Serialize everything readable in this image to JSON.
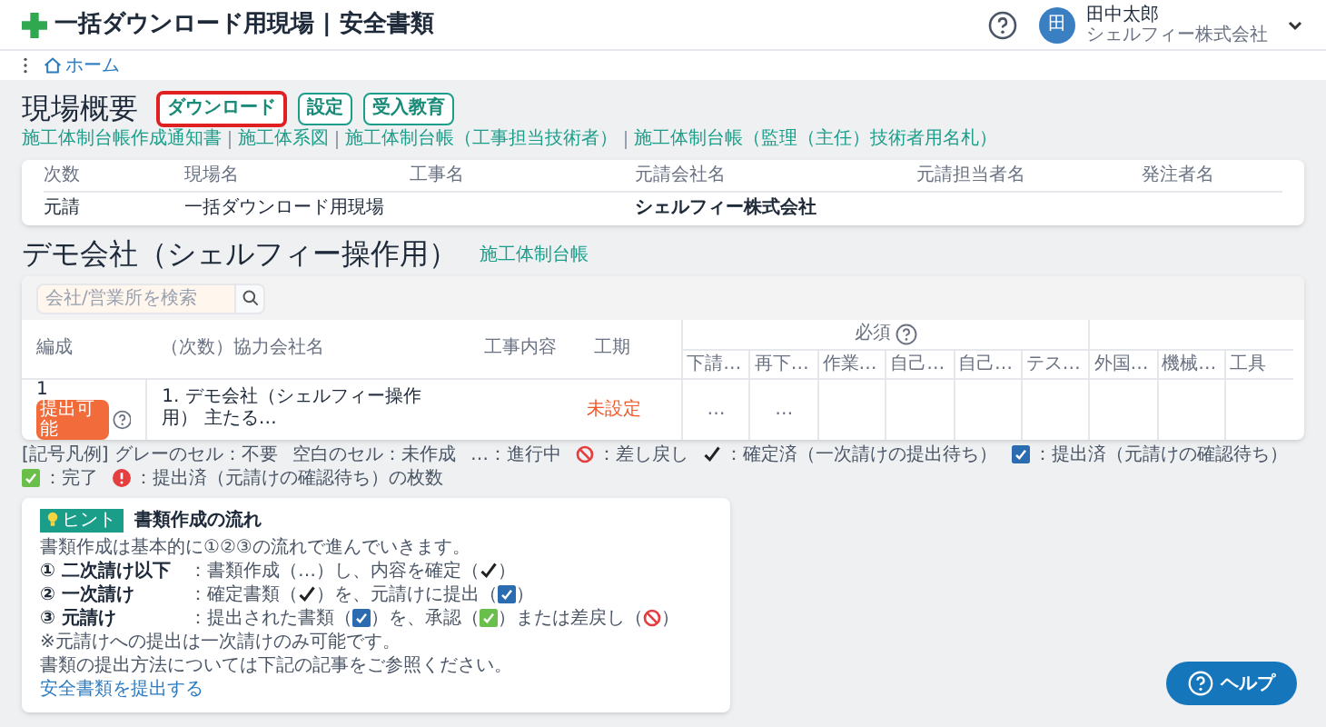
{
  "header": {
    "title": "一括ダウンロード用現場 | 安全書類",
    "user": {
      "avatar": "田",
      "name": "田中太郎",
      "company": "シェルフィー株式会社"
    }
  },
  "breadcrumb": [
    {
      "label": "ホーム"
    }
  ],
  "overview": {
    "title": "現場概要",
    "buttons": [
      {
        "label": "ダウンロード",
        "highlighted": true
      },
      {
        "label": "設定",
        "highlighted": false
      },
      {
        "label": "受入教育",
        "highlighted": false
      }
    ],
    "links": [
      "施工体制台帳作成通知書",
      "施工体系図",
      "施工体制台帳（工事担当技術者）",
      "施工体制台帳（監理（主任）技術者用名札）"
    ],
    "table": {
      "columns": [
        {
          "label": "次数",
          "value": "元請",
          "bold": false
        },
        {
          "label": "現場名",
          "value": "一括ダウンロード用現場",
          "bold": false
        },
        {
          "label": "工事名"
        },
        {
          "label": "元請会社名",
          "value": "シェルフィー株式会社",
          "bold": true
        },
        {
          "label": "元請担当者名"
        },
        {
          "label": "発注者名"
        }
      ]
    }
  },
  "company": {
    "title": "デモ会社（シェルフィー操作用）",
    "link": "施工体制台帳",
    "search": {
      "placeholder": "会社/営業所を検索"
    },
    "columns": [
      "編成",
      "（次数）協力会社名",
      "工事内容",
      "工期"
    ],
    "groups": [
      {
        "label": "必須",
        "help": true,
        "columns": [
          "下請…",
          "再下…",
          "作業…",
          "自己…",
          "自己…",
          "テス…"
        ]
      },
      {
        "help": false,
        "columns": [
          "外国…",
          "機械…",
          "工具"
        ]
      }
    ],
    "rows": [
      {
        "number": "1",
        "badge": "提出可能",
        "company": "1. デモ会社（シェルフィー操作用） 主たる…",
        "period": "未設定",
        "docs": [
          "…",
          "…"
        ]
      }
    ]
  },
  "legend": [
    {
      "kind": "none",
      "text": "[記号凡例] グレーのセル：不要"
    },
    {
      "kind": "none",
      "text": "空白のセル：未作成"
    },
    {
      "kind": "none",
      "text": "…：進行中"
    },
    {
      "kind": "returned",
      "text": "：差し戻し"
    },
    {
      "kind": "confirmed",
      "text": "：確定済（一次請けの提出待ち）"
    },
    {
      "kind": "submitted",
      "text": "：提出済（元請けの確認待ち）"
    },
    {
      "kind": "done",
      "text": "：完了"
    },
    {
      "kind": "count",
      "text": "：提出済（元請けの確認待ち）の枚数"
    }
  ],
  "hint": {
    "badge": "ヒント",
    "title": "書類作成の流れ",
    "intro": "書類作成は基本的に①②③の流れで進んでいきます。",
    "steps": [
      {
        "label": "① 二次請け以下",
        "parts": [
          {
            "kind": "text",
            "text": "：書類作成（…）し、内容を確定（"
          },
          {
            "kind": "confirmed"
          },
          {
            "kind": "text",
            "text": "）"
          }
        ]
      },
      {
        "label": "② 一次請け",
        "parts": [
          {
            "kind": "text",
            "text": "：確定書類（"
          },
          {
            "kind": "confirmed"
          },
          {
            "kind": "text",
            "text": "）を、元請けに提出（"
          },
          {
            "kind": "submitted"
          },
          {
            "kind": "text",
            "text": "）"
          }
        ]
      },
      {
        "label": "③ 元請け",
        "parts": [
          {
            "kind": "text",
            "text": "：提出された書類（"
          },
          {
            "kind": "submitted"
          },
          {
            "kind": "text",
            "text": "）を、承認（"
          },
          {
            "kind": "done"
          },
          {
            "kind": "text",
            "text": "）または差戻し（"
          },
          {
            "kind": "returned"
          },
          {
            "kind": "text",
            "text": "）"
          }
        ]
      }
    ],
    "notes": [
      "※元請けへの提出は一次請けのみ可能です。",
      "書類の提出方法については下記の記事をご参照ください。"
    ],
    "link": "安全書類を提出する"
  },
  "help_button": "ヘルプ"
}
